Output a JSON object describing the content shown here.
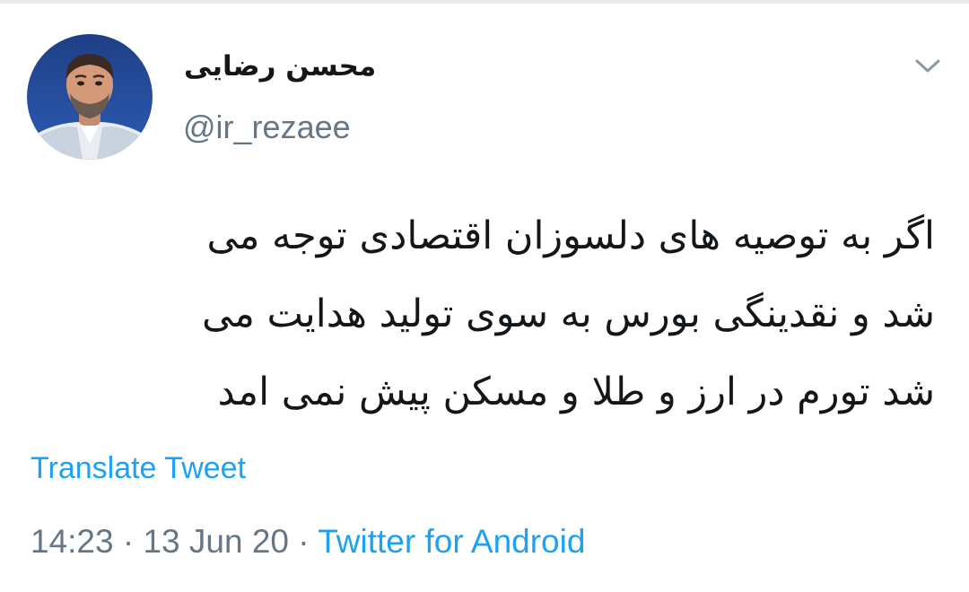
{
  "author": {
    "display_name": "محسن رضایی",
    "handle": "@ir_rezaee"
  },
  "tweet": {
    "lines": [
      "اگر به توصیه های دلسوزان اقتصادی توجه می",
      "شد و نقدینگی بورس به سوی تولید هدایت می",
      "شد تورم در ارز و طلا و مسکن پیش نمی امد"
    ]
  },
  "translate_label": "Translate Tweet",
  "meta": {
    "time": "14:23",
    "date": "13 Jun 20",
    "separator": "·",
    "source": "Twitter for Android"
  },
  "icons": {
    "caret": "chevron-down-icon",
    "avatar": "avatar"
  },
  "colors": {
    "link": "#1da1f2",
    "secondary": "#657786",
    "text": "#14171a"
  }
}
